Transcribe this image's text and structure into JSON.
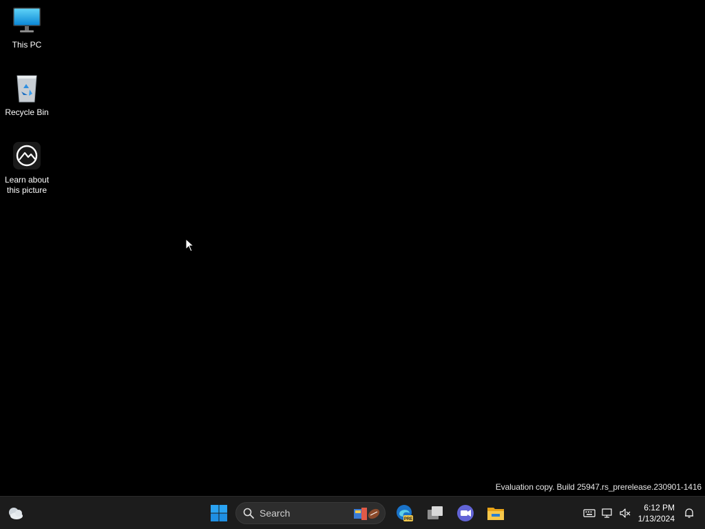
{
  "desktop": {
    "icons": [
      {
        "label": "This PC",
        "icon": "monitor-icon"
      },
      {
        "label": "Recycle Bin",
        "icon": "recycle-bin-icon"
      },
      {
        "label": "Learn about this picture",
        "icon": "learn-picture-icon"
      }
    ],
    "watermark": "Evaluation copy. Build 25947.rs_prerelease.230901-1416"
  },
  "taskbar": {
    "search_placeholder": "Search",
    "apps": [
      {
        "icon": "windows-start-icon"
      },
      {
        "icon": "edge-preview-icon",
        "badge": "PRE"
      },
      {
        "icon": "task-view-icon"
      },
      {
        "icon": "teams-meet-icon"
      },
      {
        "icon": "file-explorer-icon"
      }
    ],
    "tray": {
      "time": "6:12 PM",
      "date": "1/13/2024"
    }
  },
  "colors": {
    "background": "#000000",
    "taskbar": "#1c1c1c",
    "accent": "#0078d4"
  }
}
